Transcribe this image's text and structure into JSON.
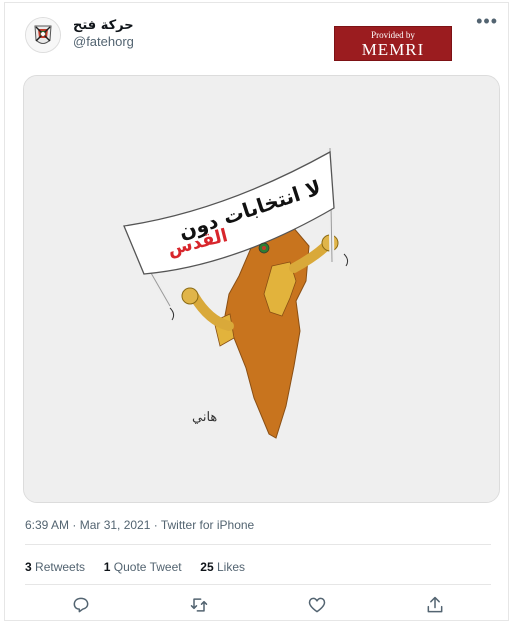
{
  "header": {
    "display_name": "حركة فتح",
    "handle": "@fatehorg",
    "more_label": "•••"
  },
  "watermark": {
    "line1": "Provided by",
    "line2": "MEMRI"
  },
  "cartoon": {
    "banner_text_1": "لا انتخابات دون",
    "banner_text_2": "القدس",
    "signature": "ﻫﺎﻧﻲ"
  },
  "meta": {
    "timestamp": "6:39 AM · Mar 31, 2021 · Twitter for iPhone"
  },
  "stats": {
    "retweets_count": "3",
    "retweets_label": "Retweets",
    "quotes_count": "1",
    "quotes_label": "Quote Tweet",
    "likes_count": "25",
    "likes_label": "Likes"
  },
  "actions": [
    {
      "icon": "reply-icon"
    },
    {
      "icon": "retweet-icon"
    },
    {
      "icon": "like-icon"
    },
    {
      "icon": "share-icon"
    }
  ],
  "colors": {
    "memri_red": "#9b1c1f",
    "map_orange": "#c8741e",
    "banner_red": "#d8262c",
    "text_gray": "#536471"
  }
}
